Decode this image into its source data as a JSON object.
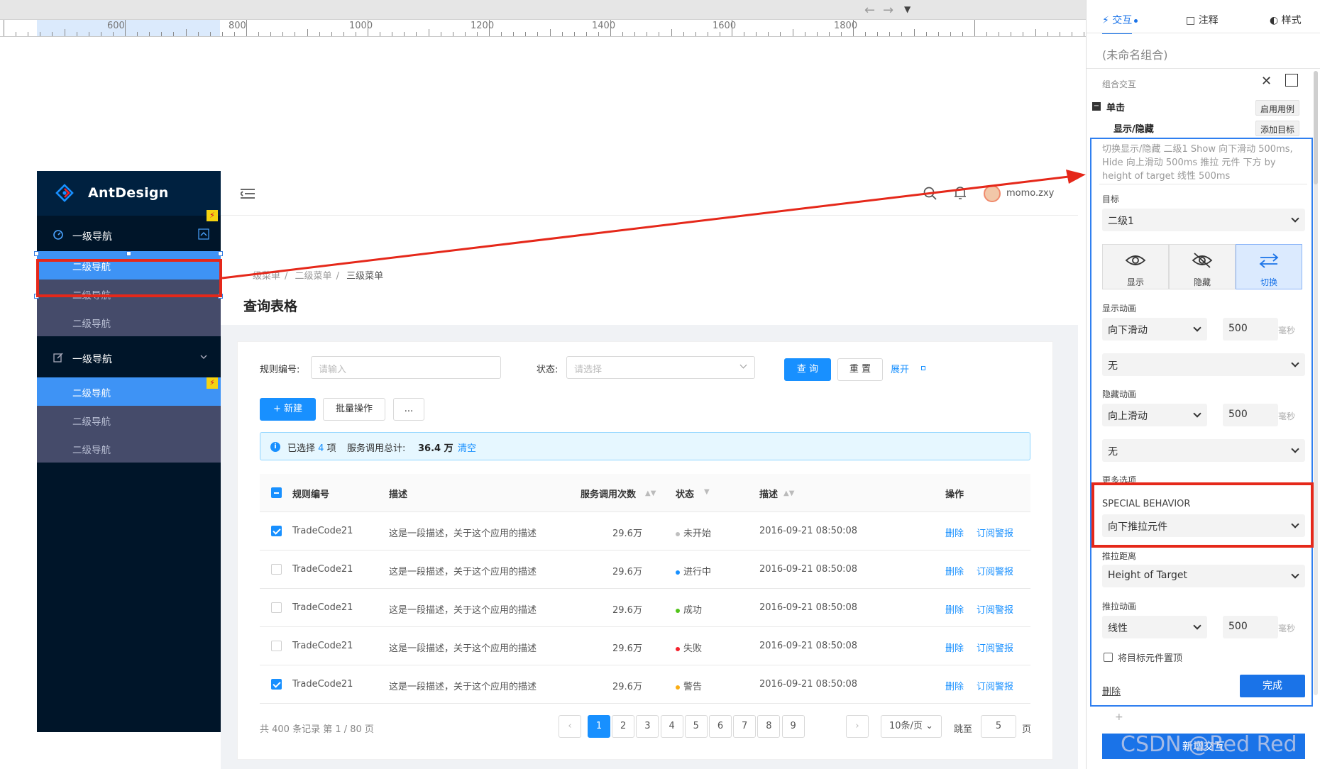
{
  "ruler": {
    "labels": [
      "600",
      "800",
      "1000",
      "1200",
      "1400",
      "1600",
      "1800"
    ]
  },
  "topbar": {
    "back_icon": "arrow-left-icon",
    "forward_icon": "arrow-right-icon",
    "dropdown_icon": "caret-down-icon"
  },
  "sidebar": {
    "logo_text": "AntDesign",
    "group1": {
      "label": "一级导航",
      "icon": "dashboard-icon",
      "expanded": true
    },
    "group1_items": [
      "二级导航",
      "二级导航",
      "二级导航"
    ],
    "group2": {
      "label": "一级导航",
      "icon": "form-edit-icon",
      "expanded": false
    },
    "group2_items": [
      "二级导航",
      "二级导航",
      "二级导航"
    ]
  },
  "header": {
    "username": "momo.zxy"
  },
  "breadcrumb": [
    "一级菜单",
    "二级菜单",
    "三级菜单"
  ],
  "page_title": "查询表格",
  "filter": {
    "rule_label": "规则编号:",
    "rule_placeholder": "请输入",
    "status_label": "状态:",
    "status_placeholder": "请选择",
    "query_btn": "查 询",
    "reset_btn": "重 置",
    "expand_link": "展开"
  },
  "actions": {
    "new_btn": "+ 新建",
    "batch_btn": "批量操作",
    "more_btn": "..."
  },
  "alert": {
    "selected_pre": "已选择",
    "selected_count": "4",
    "selected_post": "项",
    "service_label": "服务调用总计:",
    "service_total": "36.4 万",
    "clear": "清空"
  },
  "table": {
    "headers": [
      "规则编号",
      "描述",
      "服务调用次数",
      "状态",
      "描述",
      "操作"
    ],
    "rows": [
      {
        "checked": true,
        "code": "TradeCode21",
        "desc": "这是一段描述，关于这个应用的描述",
        "calls": "29.6万",
        "status": "未开始",
        "status_color": "#bfbfbf",
        "time": "2016-09-21  08:50:08",
        "op1": "删除",
        "op2": "订阅警报"
      },
      {
        "checked": false,
        "code": "TradeCode21",
        "desc": "这是一段描述，关于这个应用的描述",
        "calls": "29.6万",
        "status": "进行中",
        "status_color": "#1890ff",
        "time": "2016-09-21  08:50:08",
        "op1": "删除",
        "op2": "订阅警报"
      },
      {
        "checked": false,
        "code": "TradeCode21",
        "desc": "这是一段描述，关于这个应用的描述",
        "calls": "29.6万",
        "status": "成功",
        "status_color": "#52c41a",
        "time": "2016-09-21  08:50:08",
        "op1": "删除",
        "op2": "订阅警报"
      },
      {
        "checked": false,
        "code": "TradeCode21",
        "desc": "这是一段描述，关于这个应用的描述",
        "calls": "29.6万",
        "status": "失败",
        "status_color": "#f5222d",
        "time": "2016-09-21  08:50:08",
        "op1": "删除",
        "op2": "订阅警报"
      },
      {
        "checked": true,
        "code": "TradeCode21",
        "desc": "这是一段描述，关于这个应用的描述",
        "calls": "29.6万",
        "status": "警告",
        "status_color": "#faad14",
        "time": "2016-09-21  08:50:08",
        "op1": "删除",
        "op2": "订阅警报"
      }
    ]
  },
  "pagination": {
    "summary": "共 400 条记录 第 1 / 80 页",
    "pages": [
      "1",
      "2",
      "3",
      "4",
      "5",
      "6",
      "7",
      "8",
      "9"
    ],
    "current": "1",
    "page_size": "10条/页",
    "jump_label": "跳至",
    "jump_value": "5",
    "page_suffix": "页"
  },
  "panel": {
    "tabs": [
      {
        "label": "交互",
        "icon": "lightning-icon"
      },
      {
        "label": "注释",
        "icon": "comment-icon"
      },
      {
        "label": "样式",
        "icon": "palette-icon"
      }
    ],
    "group_name": "(未命名组合)",
    "section_label": "组合交互",
    "event_label": "单击",
    "enable_case_btn": "启用用例",
    "action_label": "显示/隐藏",
    "add_target_btn": "添加目标",
    "action_summary": "切换显示/隐藏 二级1 Show 向下滑动 500ms, Hide 向上滑动 500ms 推拉 元件 下方 by height of target 线性 500ms",
    "target_label": "目标",
    "target_value": "二级1",
    "modes": [
      {
        "label": "显示",
        "icon": "eye-icon"
      },
      {
        "label": "隐藏",
        "icon": "eye-off-icon"
      },
      {
        "label": "切换",
        "icon": "toggle-arrows-icon"
      }
    ],
    "show_anim_label": "显示动画",
    "show_anim_value": "向下滑动",
    "show_anim_ms": "500",
    "ms_unit": "毫秒",
    "show_extra_value": "无",
    "hide_anim_label": "隐藏动画",
    "hide_anim_value": "向上滑动",
    "hide_anim_ms": "500",
    "hide_extra_value": "无",
    "more_options": "更多选项",
    "special_label": "SPECIAL BEHAVIOR",
    "special_value": "向下推拉元件",
    "push_dist_label": "推拉距离",
    "push_dist_value": "Height of Target",
    "push_anim_label": "推拉动画",
    "push_anim_value": "线性",
    "push_anim_ms": "500",
    "bring_front_label": "将目标元件置顶",
    "delete_label": "删除",
    "done_btn": "完成",
    "add_plus": "+",
    "add_interaction_btn": "新增交互"
  },
  "watermark": "CSDN @Red Red",
  "colors": {
    "annotation_red": "#e5281a",
    "primary_blue": "#1890ff",
    "axure_blue": "#1a73e8",
    "sider_dark": "#001529"
  }
}
